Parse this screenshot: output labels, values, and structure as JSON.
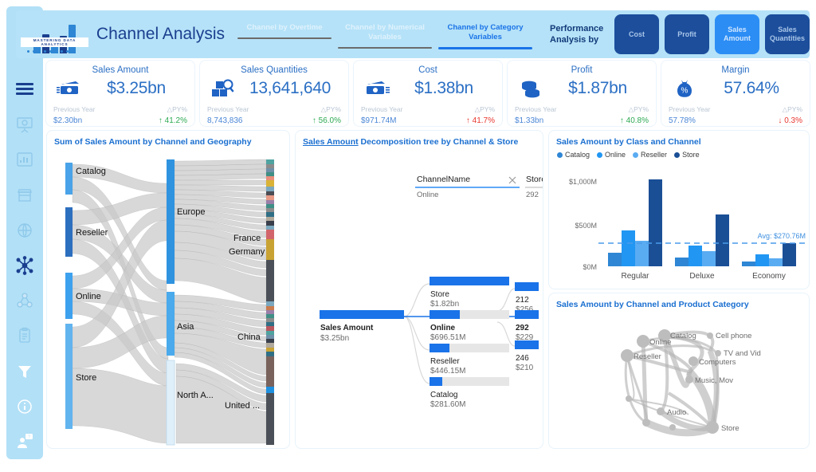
{
  "header": {
    "logo_text": "MASTERING DATA ANALYTICS",
    "title": "Channel Analysis",
    "tabs": [
      {
        "label": "Channel by Overtime",
        "active": false
      },
      {
        "label": "Channel by Numerical Variables",
        "active": false
      },
      {
        "label": "Channel by Category Variables",
        "active": true
      }
    ],
    "performance_label": "Performance Analysis by",
    "metric_buttons": [
      {
        "label": "Cost",
        "selected": false
      },
      {
        "label": "Profit",
        "selected": false
      },
      {
        "label": "Sales Amount",
        "selected": true
      },
      {
        "label": "Sales Quantities",
        "selected": true
      }
    ]
  },
  "sidebar": {
    "items": [
      {
        "icon": "hamburger-menu-icon",
        "state": "dark"
      },
      {
        "icon": "presentation-chart-icon",
        "state": "muted"
      },
      {
        "icon": "bar-chart-icon",
        "state": "muted"
      },
      {
        "icon": "store-icon",
        "state": "muted"
      },
      {
        "icon": "globe-icon",
        "state": "muted"
      },
      {
        "icon": "network-nodes-icon",
        "state": "dark"
      },
      {
        "icon": "cluster-icon",
        "state": "muted"
      },
      {
        "icon": "clipboard-icon",
        "state": "muted"
      },
      {
        "icon": "filter-funnel-icon",
        "state": "white"
      },
      {
        "icon": "info-icon",
        "state": "white"
      },
      {
        "icon": "user-help-icon",
        "state": "white"
      }
    ]
  },
  "kpis": [
    {
      "title": "Sales Amount",
      "value": "$3.25bn",
      "icon": "cash-banknote-icon",
      "prev_label": "Previous Year",
      "delta_label": "△PY%",
      "prev_value": "$2.30bn",
      "delta_value": "41.2%",
      "direction": "up",
      "arrow": "↑"
    },
    {
      "title": "Sales Quantities",
      "value": "13,641,640",
      "icon": "boxes-search-icon",
      "prev_label": "Previous Year",
      "delta_label": "△PY%",
      "prev_value": "8,743,836",
      "delta_value": "56.0%",
      "direction": "up",
      "arrow": "↑"
    },
    {
      "title": "Cost",
      "value": "$1.38bn",
      "icon": "cash-outflow-icon",
      "prev_label": "Previous Year",
      "delta_label": "△PY%",
      "prev_value": "$971.74M",
      "delta_value": "41.7%",
      "direction": "down",
      "arrow": "↑"
    },
    {
      "title": "Profit",
      "value": "$1.87bn",
      "icon": "coins-stack-icon",
      "prev_label": "Previous Year",
      "delta_label": "△PY%",
      "prev_value": "$1.33bn",
      "delta_value": "40.8%",
      "direction": "up",
      "arrow": "↑"
    },
    {
      "title": "Margin",
      "value": "57.64%",
      "icon": "money-bag-percent-icon",
      "prev_label": "Previous Year",
      "delta_label": "△PY%",
      "prev_value": "57.78%",
      "delta_value": "0.3%",
      "direction": "down",
      "arrow": "↓"
    }
  ],
  "sankey": {
    "title": "Sum of Sales Amount by Channel and Geography",
    "channels": [
      "Catalog",
      "Reseller",
      "Online",
      "Store"
    ],
    "continents": [
      "Europe",
      "Asia",
      "North A..."
    ],
    "countries": [
      "France",
      "Germany",
      "China",
      "United ..."
    ]
  },
  "tree": {
    "title_link": "Sales Amount",
    "title_rest": " Decomposition tree by Channel & Store",
    "filters": [
      {
        "field": "ChannelName",
        "value": "Online",
        "has_clear": true
      },
      {
        "field": "Store",
        "value": "292",
        "has_clear": false
      }
    ],
    "root": {
      "label": "Sales Amount",
      "value": "$3.25bn"
    },
    "level1": [
      {
        "label": "Store",
        "value": "$1.82bn",
        "fill": 1.0,
        "selected": false
      },
      {
        "label": "Online",
        "value": "$696.51M",
        "fill": 0.38,
        "selected": true
      },
      {
        "label": "Reseller",
        "value": "$446.15M",
        "fill": 0.245,
        "selected": false
      },
      {
        "label": "Catalog",
        "value": "$281.60M",
        "fill": 0.155,
        "selected": false
      }
    ],
    "level2": [
      {
        "label": "212",
        "value": "$256",
        "fill": 1.0,
        "selected": false
      },
      {
        "label": "292",
        "value": "$229",
        "fill": 0.9,
        "selected": true
      },
      {
        "label": "246",
        "value": "$210",
        "fill": 0.82,
        "selected": false
      }
    ]
  },
  "chart_data": {
    "type": "bar",
    "title": "Sales Amount by Class and Channel",
    "xlabel": "",
    "ylabel": "",
    "categories": [
      "Regular",
      "Deluxe",
      "Economy"
    ],
    "series": [
      {
        "name": "Catalog",
        "color": "#2e86d4",
        "values": [
          155,
          105,
          55
        ]
      },
      {
        "name": "Online",
        "color": "#2196f3",
        "values": [
          410,
          240,
          140
        ]
      },
      {
        "name": "Reseller",
        "color": "#5aacf2",
        "values": [
          290,
          175,
          90
        ]
      },
      {
        "name": "Store",
        "color": "#1a4f96",
        "values": [
          1000,
          600,
          265
        ]
      }
    ],
    "ylim": [
      0,
      1100
    ],
    "yticks": [
      0,
      500,
      1000
    ],
    "ytick_labels": [
      "$0M",
      "$500M",
      "$1,000M"
    ],
    "average_line": {
      "label": "Avg: $270.76M",
      "value": 270.76,
      "color": "#4a9bea"
    },
    "grid": false,
    "legend_position": "top"
  },
  "network": {
    "title": "Sales Amount by Channel and Product Category",
    "nodes": [
      "Catalog",
      "Online",
      "Reseller",
      "Cell phone",
      "TV and Vid",
      "Computers",
      "Music, Mov",
      "Audio",
      "Store"
    ]
  }
}
